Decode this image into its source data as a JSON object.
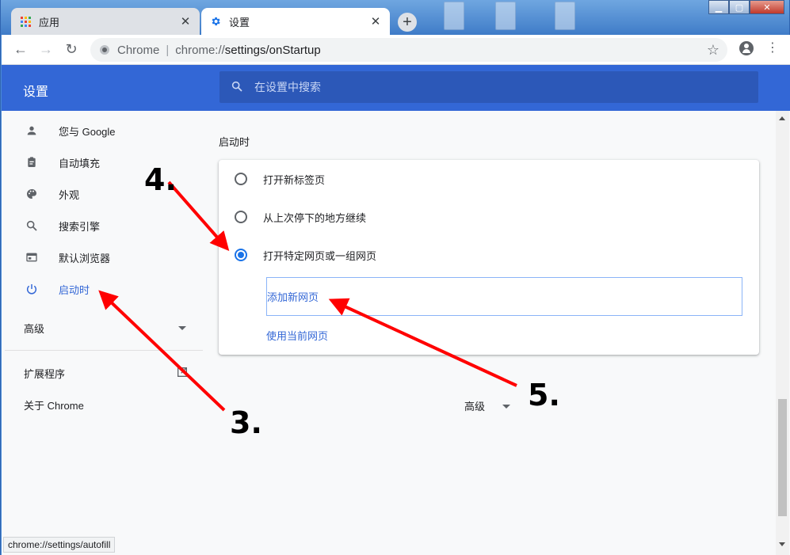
{
  "tabs": [
    {
      "label": "应用",
      "icon": "apps-grid-icon"
    },
    {
      "label": "设置",
      "icon": "gear-icon"
    }
  ],
  "toolbar": {
    "site_label": "Chrome",
    "url_scheme": "chrome://",
    "url_path": "settings/onStartup"
  },
  "header": {
    "title": "设置",
    "search_placeholder": "在设置中搜索"
  },
  "sidebar": {
    "items": [
      {
        "label": "您与 Google",
        "icon": "person-icon"
      },
      {
        "label": "自动填充",
        "icon": "clipboard-icon"
      },
      {
        "label": "外观",
        "icon": "palette-icon"
      },
      {
        "label": "搜索引擎",
        "icon": "search-icon"
      },
      {
        "label": "默认浏览器",
        "icon": "browser-window-icon"
      },
      {
        "label": "启动时",
        "icon": "power-icon",
        "active": true
      }
    ],
    "advanced": "高级",
    "extensions": "扩展程序",
    "about": "关于 Chrome"
  },
  "main": {
    "section_title": "启动时",
    "options": [
      {
        "label": "打开新标签页",
        "selected": false
      },
      {
        "label": "从上次停下的地方继续",
        "selected": false
      },
      {
        "label": "打开特定网页或一组网页",
        "selected": true
      }
    ],
    "add_page": "添加新网页",
    "use_current": "使用当前网页",
    "advanced": "高级"
  },
  "status_url": "chrome://settings/autofill",
  "annotations": [
    "3.",
    "4.",
    "5."
  ],
  "colors": {
    "accent": "#3367d6",
    "arrow": "#ff0000"
  }
}
